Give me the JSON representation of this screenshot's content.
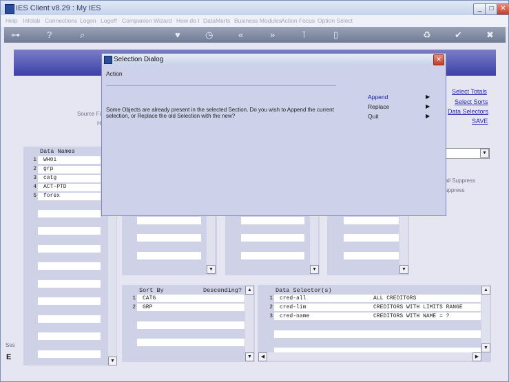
{
  "window": {
    "title": "IES Client v8.29 : My IES"
  },
  "menu": [
    "Help",
    "Infolab",
    "Connections",
    "Logon",
    "Logoff",
    "Companion",
    "Wizard",
    "How do I",
    "DataMarts",
    "Business Modules",
    "Action Focus",
    "Option Select"
  ],
  "right_links": [
    "Select Totals",
    "Select Sorts",
    "Data Selectors",
    "SAVE"
  ],
  "side_labels": {
    "source": "Source Fi",
    "h": "H",
    "left_bottom": "Ses",
    "e_mark": "E"
  },
  "suppress": [
    "ail Suppress",
    "uppress"
  ],
  "data_names": {
    "header": "Data Names",
    "items": [
      {
        "num": "1",
        "name": "WH01"
      },
      {
        "num": "2",
        "name": "grp"
      },
      {
        "num": "3",
        "name": "catg"
      },
      {
        "num": "4",
        "name": "ACT-PTD"
      },
      {
        "num": "5",
        "name": "forex"
      }
    ]
  },
  "sort_by": {
    "header": "Sort By",
    "header_right": "Descending?",
    "items": [
      {
        "num": "1",
        "name": "CATG"
      },
      {
        "num": "2",
        "name": "GRP"
      }
    ]
  },
  "data_selectors": {
    "header": "Data Selector(s)",
    "items": [
      {
        "num": "1",
        "name": "cred-all",
        "desc": "ALL CREDITORS"
      },
      {
        "num": "2",
        "name": "cred-lim",
        "desc": "CREDITORS WITH LIMITS RANGE"
      },
      {
        "num": "3",
        "name": "cred-name",
        "desc": "CREDITORS WITH NAME = ?"
      }
    ]
  },
  "dialog": {
    "title": "Selection Dialog",
    "section": "Action",
    "message": "Some Objects are already present in the selected Section. Do you wish to Append the current selection, or Replace the old Selection with the new?",
    "options": [
      {
        "label": "Append",
        "selected": true
      },
      {
        "label": "Replace",
        "selected": false
      },
      {
        "label": "Quit",
        "selected": false
      }
    ]
  }
}
